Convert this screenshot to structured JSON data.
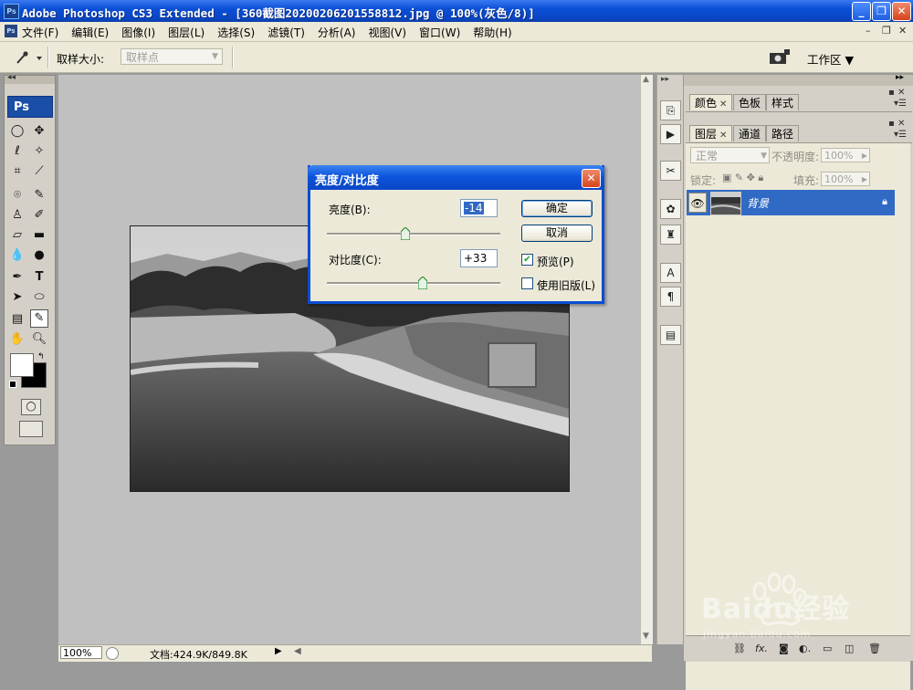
{
  "window": {
    "title": "Adobe Photoshop CS3 Extended - [360截图20200206201558812.jpg @ 100%(灰色/8)]",
    "app_icon": "Ps"
  },
  "menu": [
    "文件(F)",
    "编辑(E)",
    "图像(I)",
    "图层(L)",
    "选择(S)",
    "滤镜(T)",
    "分析(A)",
    "视图(V)",
    "窗口(W)",
    "帮助(H)"
  ],
  "options": {
    "tool_icon": "eyedropper-icon",
    "sample_size_label": "取样大小:",
    "sample_size_value": "取样点",
    "workspace_label": "工作区"
  },
  "tools": {
    "logo": "Ps"
  },
  "status": {
    "zoom": "100%",
    "doc_info": "文档:424.9K/849.8K"
  },
  "panels": {
    "top_tabs": [
      "颜色",
      "色板",
      "样式"
    ],
    "layer_tabs": [
      "图层",
      "通道",
      "路径"
    ],
    "blend_mode": "正常",
    "opacity_label": "不透明度:",
    "opacity_value": "100%",
    "lock_label": "锁定:",
    "fill_label": "填充:",
    "fill_value": "100%",
    "layer_name": "背景"
  },
  "dialog": {
    "title": "亮度/对比度",
    "brightness_label": "亮度(B):",
    "brightness_value": "-14",
    "brightness_level": -14,
    "contrast_label": "对比度(C):",
    "contrast_value": "+33",
    "contrast_level": 33,
    "ok_label": "确定",
    "cancel_label": "取消",
    "preview_label": "预览(P)",
    "preview_checked": true,
    "legacy_label": "使用旧版(L)",
    "legacy_checked": false
  },
  "watermark": {
    "brand": "Baidu经验",
    "url": "jingyan.baidu.com"
  }
}
